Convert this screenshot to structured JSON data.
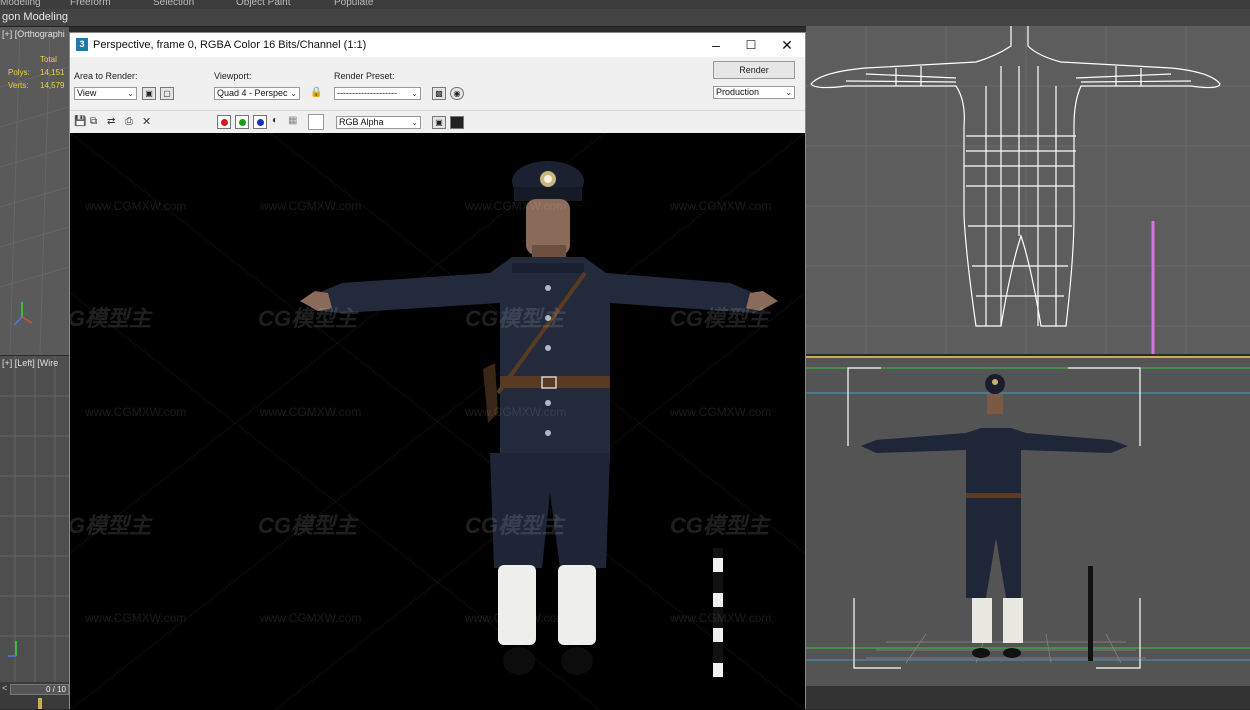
{
  "ribbon": {
    "tabs": [
      "Modeling",
      "Freeform",
      "Selection",
      "Object Paint",
      "Populate"
    ],
    "sub_label": "gon Modeling"
  },
  "viewports": {
    "top_left": {
      "label": "[+] [Orthographi",
      "stats": {
        "total": "Total",
        "polys_label": "Polys:",
        "polys_value": "14,151",
        "verts_label": "Verts:",
        "verts_value": "14,579"
      }
    },
    "bottom_left": {
      "label": "[+] [Left] [Wire"
    },
    "timeline": {
      "frame": "0 / 10"
    }
  },
  "render_window": {
    "title": "Perspective, frame 0, RGBA Color 16 Bits/Channel (1:1)",
    "controls": {
      "area_label": "Area to Render:",
      "area_value": "View",
      "viewport_label": "Viewport:",
      "viewport_value": "Quad 4 - Perspec",
      "preset_label": "Render Preset:",
      "preset_value": "--------------------",
      "render_button": "Render",
      "mode_value": "Production",
      "channel_value": "RGB Alpha"
    },
    "watermark_url": "www.CGMXW.com",
    "watermark_logo": "CG模型主"
  }
}
